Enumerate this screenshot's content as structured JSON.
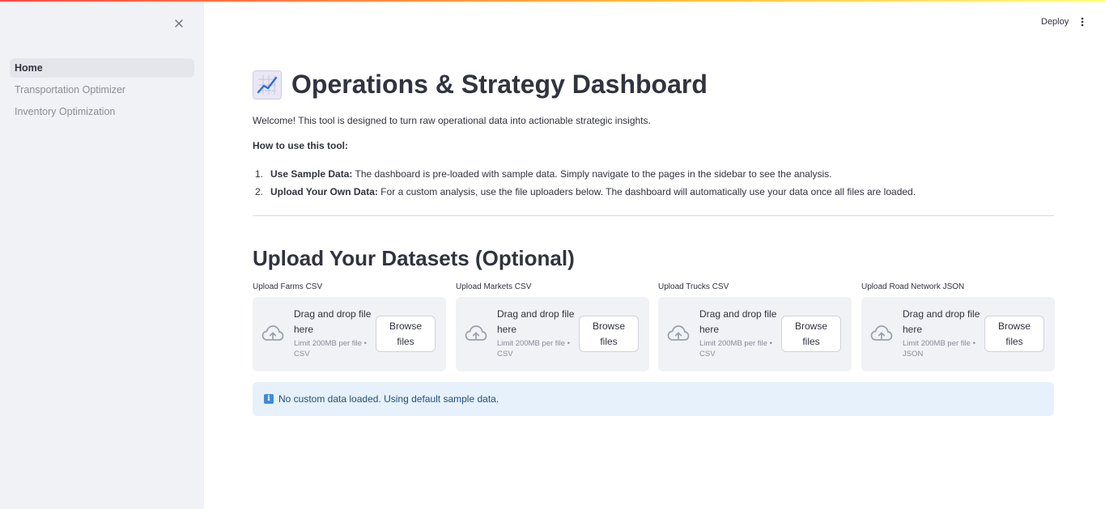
{
  "colors": {
    "accent_gradient": [
      "#ff4b4b",
      "#ffbd45",
      "#fffd80"
    ],
    "sidebar_bg": "#f0f2f6",
    "info_bg": "#e6f1fc",
    "info_text": "#1f4f7a"
  },
  "sidebar": {
    "close_icon": "close-icon",
    "items": [
      {
        "label": "Home",
        "active": true
      },
      {
        "label": "Transportation Optimizer",
        "active": false
      },
      {
        "label": "Inventory Optimization",
        "active": false
      }
    ]
  },
  "header": {
    "deploy_label": "Deploy",
    "menu_icon": "kebab-menu-icon"
  },
  "main": {
    "title_icon": "chart-increasing-icon",
    "title": "Operations & Strategy Dashboard",
    "welcome": "Welcome! This tool is designed to turn raw operational data into actionable strategic insights.",
    "howto_heading": "How to use this tool:",
    "steps": [
      {
        "num": "1.",
        "bold": "Use Sample Data:",
        "text": " The dashboard is pre-loaded with sample data. Simply navigate to the pages in the sidebar to see the analysis."
      },
      {
        "num": "2.",
        "bold": "Upload Your Own Data:",
        "text": " For a custom analysis, use the file uploaders below. The dashboard will automatically use your data once all files are loaded."
      }
    ],
    "upload_heading": "Upload Your Datasets (Optional)",
    "uploaders": [
      {
        "label": "Upload Farms CSV",
        "drag_line1": "Drag and drop file",
        "drag_line2": "here",
        "limit_line1": "Limit 200MB per file •",
        "limit_line2": "CSV",
        "browse_line1": "Browse",
        "browse_line2": "files"
      },
      {
        "label": "Upload Markets CSV",
        "drag_line1": "Drag and drop file",
        "drag_line2": "here",
        "limit_line1": "Limit 200MB per file •",
        "limit_line2": "CSV",
        "browse_line1": "Browse",
        "browse_line2": "files"
      },
      {
        "label": "Upload Trucks CSV",
        "drag_line1": "Drag and drop file",
        "drag_line2": "here",
        "limit_line1": "Limit 200MB per file •",
        "limit_line2": "CSV",
        "browse_line1": "Browse",
        "browse_line2": "files"
      },
      {
        "label": "Upload Road Network JSON",
        "drag_line1": "Drag and drop file",
        "drag_line2": "here",
        "limit_line1": "Limit 200MB per file •",
        "limit_line2": "JSON",
        "browse_line1": "Browse",
        "browse_line2": "files"
      }
    ],
    "info_icon": "info-icon",
    "info_glyph": "i",
    "info_message": "No custom data loaded. Using default sample data."
  }
}
